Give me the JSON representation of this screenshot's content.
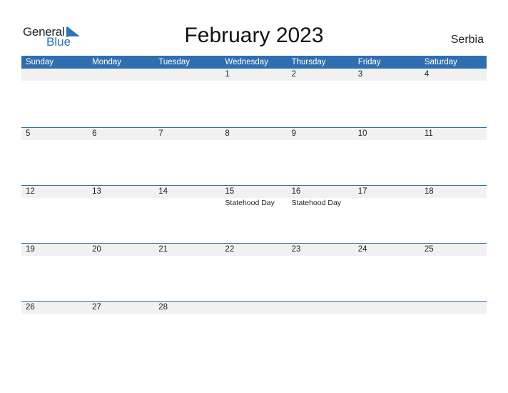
{
  "logo": {
    "general": "General",
    "blue": "Blue"
  },
  "title": "February 2023",
  "country": "Serbia",
  "colors": {
    "accent": "#2f6fb0",
    "band": "#f1f1f1",
    "logo_blue": "#2b73bd"
  },
  "weekdays": [
    "Sunday",
    "Monday",
    "Tuesday",
    "Wednesday",
    "Thursday",
    "Friday",
    "Saturday"
  ],
  "weeks": [
    [
      {
        "d": ""
      },
      {
        "d": ""
      },
      {
        "d": ""
      },
      {
        "d": "1"
      },
      {
        "d": "2"
      },
      {
        "d": "3"
      },
      {
        "d": "4"
      }
    ],
    [
      {
        "d": "5"
      },
      {
        "d": "6"
      },
      {
        "d": "7"
      },
      {
        "d": "8"
      },
      {
        "d": "9"
      },
      {
        "d": "10"
      },
      {
        "d": "11"
      }
    ],
    [
      {
        "d": "12"
      },
      {
        "d": "13"
      },
      {
        "d": "14"
      },
      {
        "d": "15",
        "e": "Statehood Day"
      },
      {
        "d": "16",
        "e": "Statehood Day"
      },
      {
        "d": "17"
      },
      {
        "d": "18"
      }
    ],
    [
      {
        "d": "19"
      },
      {
        "d": "20"
      },
      {
        "d": "21"
      },
      {
        "d": "22"
      },
      {
        "d": "23"
      },
      {
        "d": "24"
      },
      {
        "d": "25"
      }
    ],
    [
      {
        "d": "26"
      },
      {
        "d": "27"
      },
      {
        "d": "28"
      },
      {
        "d": ""
      },
      {
        "d": ""
      },
      {
        "d": ""
      },
      {
        "d": ""
      }
    ]
  ]
}
